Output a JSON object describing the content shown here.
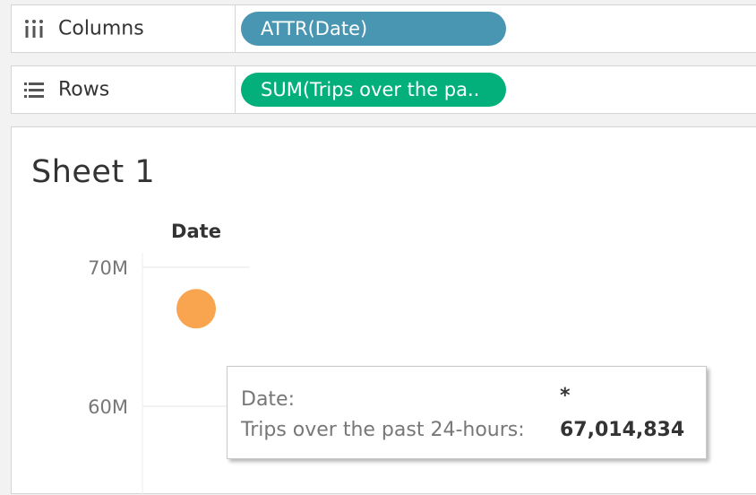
{
  "shelves": {
    "columns": {
      "label": "Columns",
      "icon": "columns-icon",
      "pill": "ATTR(Date)",
      "pill_color": "#4996b2"
    },
    "rows": {
      "label": "Rows",
      "icon": "rows-icon",
      "pill": "SUM(Trips over the pa..",
      "pill_color": "#03b07c"
    }
  },
  "sheet": {
    "title": "Sheet 1"
  },
  "chart_data": {
    "type": "scatter",
    "xlabel": "Date",
    "categories": [
      "*"
    ],
    "y_ticks": [
      "70M",
      "60M"
    ],
    "series": [
      {
        "values": [
          67014834
        ],
        "color": "#f9a54f"
      }
    ]
  },
  "tooltip": {
    "date_key": "Date:",
    "date_value": "*",
    "trips_key": "Trips over the past 24-hours:",
    "trips_value": "67,014,834"
  }
}
